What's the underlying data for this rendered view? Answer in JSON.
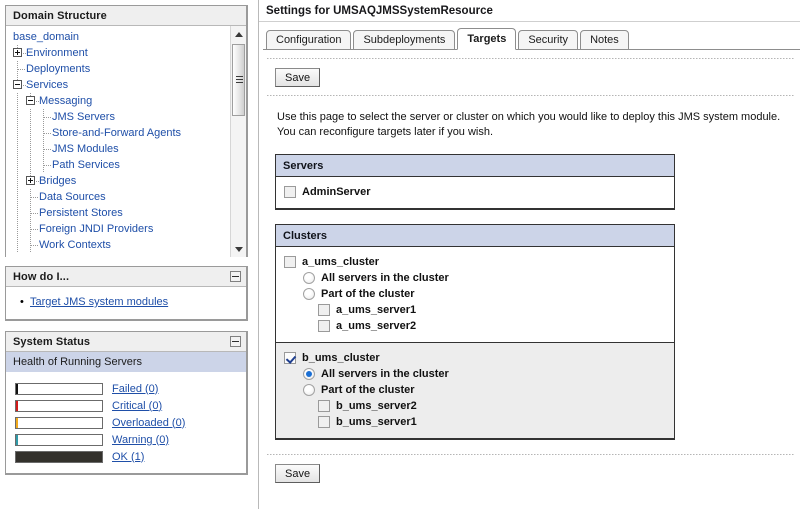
{
  "left": {
    "domain_structure": {
      "title": "Domain Structure",
      "tree": [
        {
          "label": "base_domain",
          "depth": 0,
          "node": "root"
        },
        {
          "label": "Environment",
          "depth": 1,
          "node": "plus"
        },
        {
          "label": "Deployments",
          "depth": 1,
          "node": "leaf"
        },
        {
          "label": "Services",
          "depth": 1,
          "node": "minus"
        },
        {
          "label": "Messaging",
          "depth": 2,
          "node": "minus"
        },
        {
          "label": "JMS Servers",
          "depth": 3,
          "node": "leaf"
        },
        {
          "label": "Store-and-Forward Agents",
          "depth": 3,
          "node": "leaf"
        },
        {
          "label": "JMS Modules",
          "depth": 3,
          "node": "leaf"
        },
        {
          "label": "Path Services",
          "depth": 3,
          "node": "leaf"
        },
        {
          "label": "Bridges",
          "depth": 2,
          "node": "plus"
        },
        {
          "label": "Data Sources",
          "depth": 2,
          "node": "leaf"
        },
        {
          "label": "Persistent Stores",
          "depth": 2,
          "node": "leaf"
        },
        {
          "label": "Foreign JNDI Providers",
          "depth": 2,
          "node": "leaf"
        },
        {
          "label": "Work Contexts",
          "depth": 2,
          "node": "leaf"
        }
      ]
    },
    "how_do_i": {
      "title": "How do I...",
      "collapse_icon": "minus-box-icon",
      "links": [
        {
          "label": "Target JMS system modules"
        }
      ]
    },
    "system_status": {
      "title": "System Status",
      "collapse_icon": "minus-box-icon",
      "subheading": "Health of Running Servers",
      "rows": [
        {
          "label": "Failed (0)",
          "color": "#111111",
          "filled": false
        },
        {
          "label": "Critical (0)",
          "color": "#d11a1a",
          "filled": false
        },
        {
          "label": "Overloaded (0)",
          "color": "#f0a91c",
          "filled": false
        },
        {
          "label": "Warning (0)",
          "color": "#2f9aa8",
          "filled": false
        },
        {
          "label": "OK (1)",
          "color": "#33312c",
          "filled": true
        }
      ]
    }
  },
  "content": {
    "page_title": "Settings for UMSAQJMSSystemResource",
    "tabs": [
      {
        "label": "Configuration",
        "active": false
      },
      {
        "label": "Subdeployments",
        "active": false
      },
      {
        "label": "Targets",
        "active": true
      },
      {
        "label": "Security",
        "active": false
      },
      {
        "label": "Notes",
        "active": false
      }
    ],
    "save_top_label": "Save",
    "save_bottom_label": "Save",
    "intro_text": "Use this page to select the server or cluster on which you would like to deploy this JMS system module. You can reconfigure targets later if you wish.",
    "servers_panel": {
      "header": "Servers",
      "items": [
        {
          "label": "AdminServer",
          "control": "checkbox",
          "checked": false,
          "level": 0
        }
      ]
    },
    "clusters_panel": {
      "header": "Clusters",
      "groups": [
        {
          "highlight": false,
          "items": [
            {
              "label": "a_ums_cluster",
              "control": "checkbox",
              "checked": false,
              "level": 0
            },
            {
              "label": "All servers in the cluster",
              "control": "radio",
              "checked": false,
              "level": 1
            },
            {
              "label": "Part of the cluster",
              "control": "radio",
              "checked": false,
              "level": 1
            },
            {
              "label": "a_ums_server1",
              "control": "checkbox",
              "checked": false,
              "level": 2
            },
            {
              "label": "a_ums_server2",
              "control": "checkbox",
              "checked": false,
              "level": 2
            }
          ]
        },
        {
          "highlight": true,
          "items": [
            {
              "label": "b_ums_cluster",
              "control": "checkbox",
              "checked": true,
              "level": 0
            },
            {
              "label": "All servers in the cluster",
              "control": "radio",
              "checked": true,
              "level": 1
            },
            {
              "label": "Part of the cluster",
              "control": "radio",
              "checked": false,
              "level": 1
            },
            {
              "label": "b_ums_server2",
              "control": "checkbox",
              "checked": false,
              "level": 2
            },
            {
              "label": "b_ums_server1",
              "control": "checkbox",
              "checked": false,
              "level": 2
            }
          ]
        }
      ]
    }
  },
  "colors": {
    "accent_blue": "#1f4fa8",
    "panel_header_blue": "#ccd4e8",
    "highlight_gray": "#ededed"
  }
}
